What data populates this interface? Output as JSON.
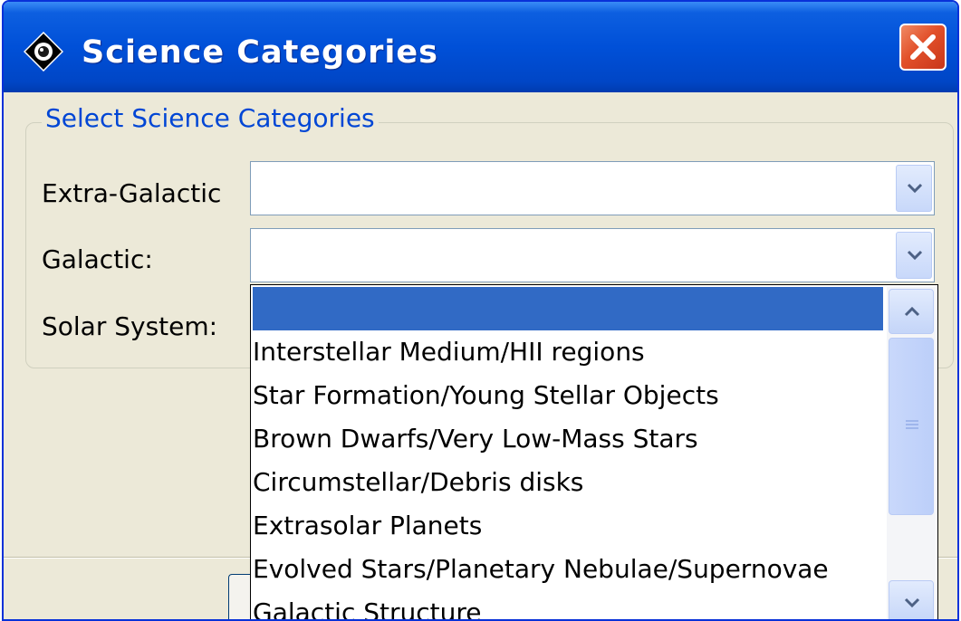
{
  "window": {
    "title": "Science Categories",
    "icon": "app-diamond-icon",
    "close_icon": "close-icon",
    "close_color": "#e2502a"
  },
  "group": {
    "title": "Select Science Categories",
    "fields": [
      {
        "label": "Extra-Galactic",
        "value": ""
      },
      {
        "label": "Galactic:",
        "value": ""
      },
      {
        "label": "Solar System:",
        "value": ""
      }
    ]
  },
  "dropdown": {
    "selected_color": "#316ac5",
    "options": [
      "",
      "Interstellar Medium/HII regions",
      "Star Formation/Young Stellar Objects",
      "Brown Dwarfs/Very Low-Mass Stars",
      "Circumstellar/Debris disks",
      "Extrasolar Planets",
      "Evolved Stars/Planetary Nebulae/Supernovae",
      "Galactic Structure"
    ]
  },
  "colors": {
    "titlebar": "#0050d8",
    "dialog_bg": "#ece9d8",
    "group_title": "#0046d5"
  }
}
